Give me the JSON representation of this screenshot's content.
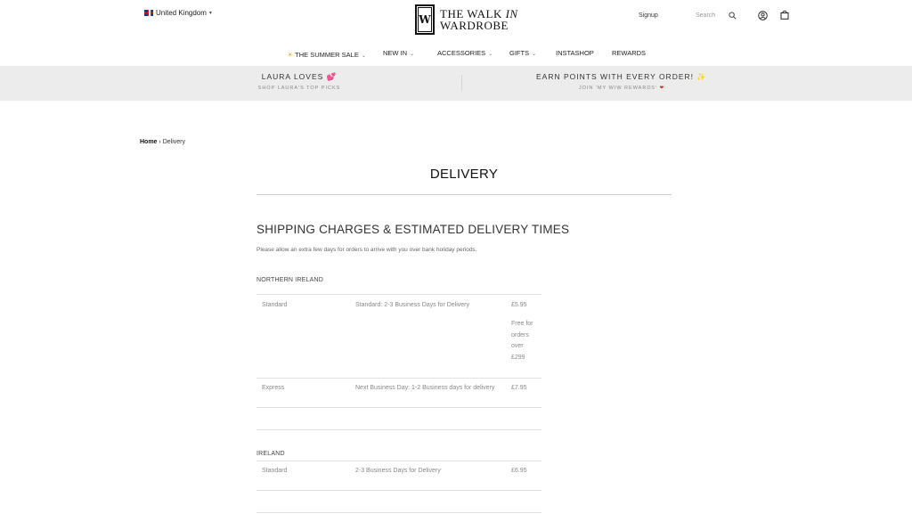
{
  "header": {
    "country": "United Kingdom",
    "logo_line1": "THE WALK",
    "logo_italic": "IN",
    "logo_line2": "WARDROBE",
    "logo_mark": "W",
    "signup": "Signup",
    "search_placeholder": "Search"
  },
  "nav": {
    "items": [
      {
        "label": "THE SUMMER SALE",
        "has_caret": true
      },
      {
        "label": "NEW IN",
        "has_caret": true
      },
      {
        "label": "ACCESSORIES",
        "has_caret": true
      },
      {
        "label": "GIFTS",
        "has_caret": true
      },
      {
        "label": "INSTASHOP",
        "has_caret": false
      },
      {
        "label": "REWARDS",
        "has_caret": false
      }
    ]
  },
  "promo": {
    "left_title": "LAURA LOVES",
    "left_sub": "SHOP LAURA'S TOP PICKS",
    "right_title": "EARN POINTS WITH EVERY ORDER!",
    "right_sub": "JOIN 'MY WIW REWARDS'"
  },
  "breadcrumb": {
    "home": "Home",
    "separator": "›",
    "current": "Delivery"
  },
  "page": {
    "title": "DELIVERY",
    "section_heading": "SHIPPING CHARGES & ESTIMATED DELIVERY TIMES",
    "note": "Please allow an extra few days for orders to arrive with you over bank holiday periods."
  },
  "regions": [
    {
      "name": "NORTHERN IRELAND",
      "rows": [
        {
          "method": "Standard",
          "time": "Standard: 2-3 Business Days for Delivery",
          "price": "£5.95",
          "extra": "Free for orders over £299"
        },
        {
          "method": "Express",
          "time": "Next Business Day: 1-2 Business days for delivery",
          "price": "£7.95",
          "extra": ""
        }
      ]
    },
    {
      "name": "IRELAND",
      "rows": [
        {
          "method": "Standard",
          "time": "2-3 Business Days for Delivery",
          "price": "£6.95",
          "extra": ""
        }
      ]
    }
  ],
  "colors": {
    "promo_bg": "#ececec",
    "text": "#222222",
    "muted": "#888888",
    "rule": "#e2e2e2"
  }
}
